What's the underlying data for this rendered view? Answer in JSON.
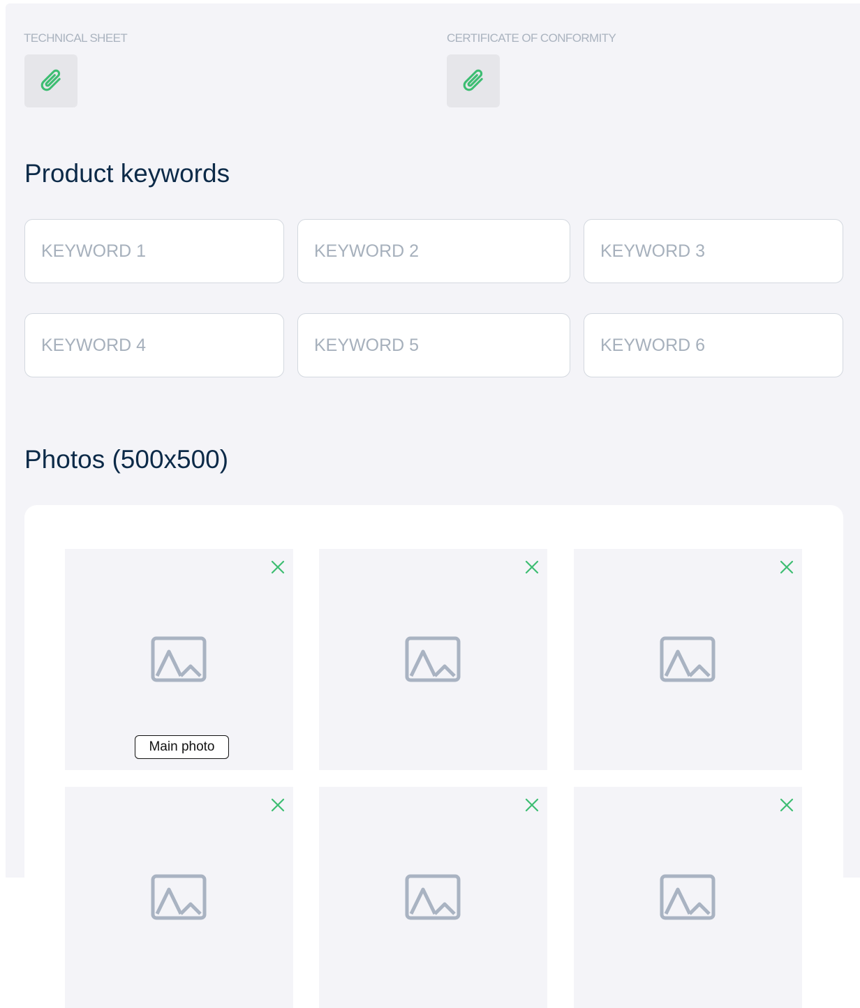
{
  "attachments": [
    {
      "label": "TECHNICAL SHEET",
      "icon": "paperclip-icon"
    },
    {
      "label": "CERTIFICATE OF CONFORMITY",
      "icon": "paperclip-icon"
    }
  ],
  "keywords": {
    "title": "Product keywords",
    "fields": [
      {
        "placeholder": "KEYWORD 1",
        "value": ""
      },
      {
        "placeholder": "KEYWORD 2",
        "value": ""
      },
      {
        "placeholder": "KEYWORD 3",
        "value": ""
      },
      {
        "placeholder": "KEYWORD 4",
        "value": ""
      },
      {
        "placeholder": "KEYWORD 5",
        "value": ""
      },
      {
        "placeholder": "KEYWORD 6",
        "value": ""
      }
    ]
  },
  "photos": {
    "title": "Photos (500x500)",
    "main_badge": "Main photo",
    "icons": {
      "placeholder": "image-placeholder-icon",
      "remove": "close-icon"
    }
  },
  "colors": {
    "accent_green": "#3dbd72",
    "heading": "#0c2a48",
    "muted": "#aab3bf",
    "panel_bg": "#f4f4f8"
  }
}
